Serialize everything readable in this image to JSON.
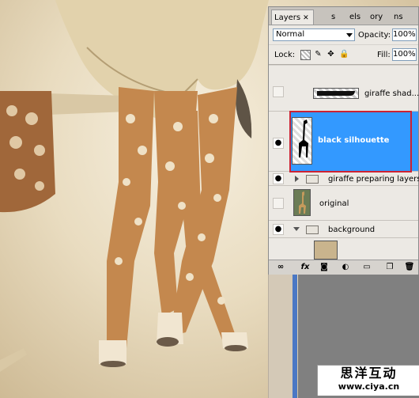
{
  "panel": {
    "tabs": [
      {
        "label": "Layers",
        "active": true
      },
      {
        "label": "s"
      },
      {
        "label": "els"
      },
      {
        "label": "ory"
      },
      {
        "label": "ns"
      }
    ],
    "blend_mode": "Normal",
    "opacity_label": "Opacity:",
    "opacity_value": "100%",
    "lock_label": "Lock:",
    "fill_label": "Fill:",
    "fill_value": "100%",
    "layers": [
      {
        "name": "giraffe shad...",
        "visible": false,
        "type": "layer"
      },
      {
        "name": "black silhouette",
        "visible": true,
        "type": "layer",
        "selected": true
      },
      {
        "name": "giraffe preparing layers",
        "visible": true,
        "type": "group",
        "expanded": false
      },
      {
        "name": "original",
        "visible": false,
        "type": "layer"
      },
      {
        "name": "background",
        "visible": true,
        "type": "group",
        "expanded": true
      }
    ],
    "bottom_icons": [
      "link-icon",
      "fx-icon",
      "mask-icon",
      "adjustment-icon",
      "new-group-icon",
      "new-layer-icon",
      "trash-icon"
    ],
    "bottom_fx_label": "fx"
  },
  "watermark": {
    "line1": "思洋互动",
    "line2": "www.ciya.cn"
  },
  "colors": {
    "selection": "#3399ff",
    "highlight_box": "#cc2233"
  }
}
